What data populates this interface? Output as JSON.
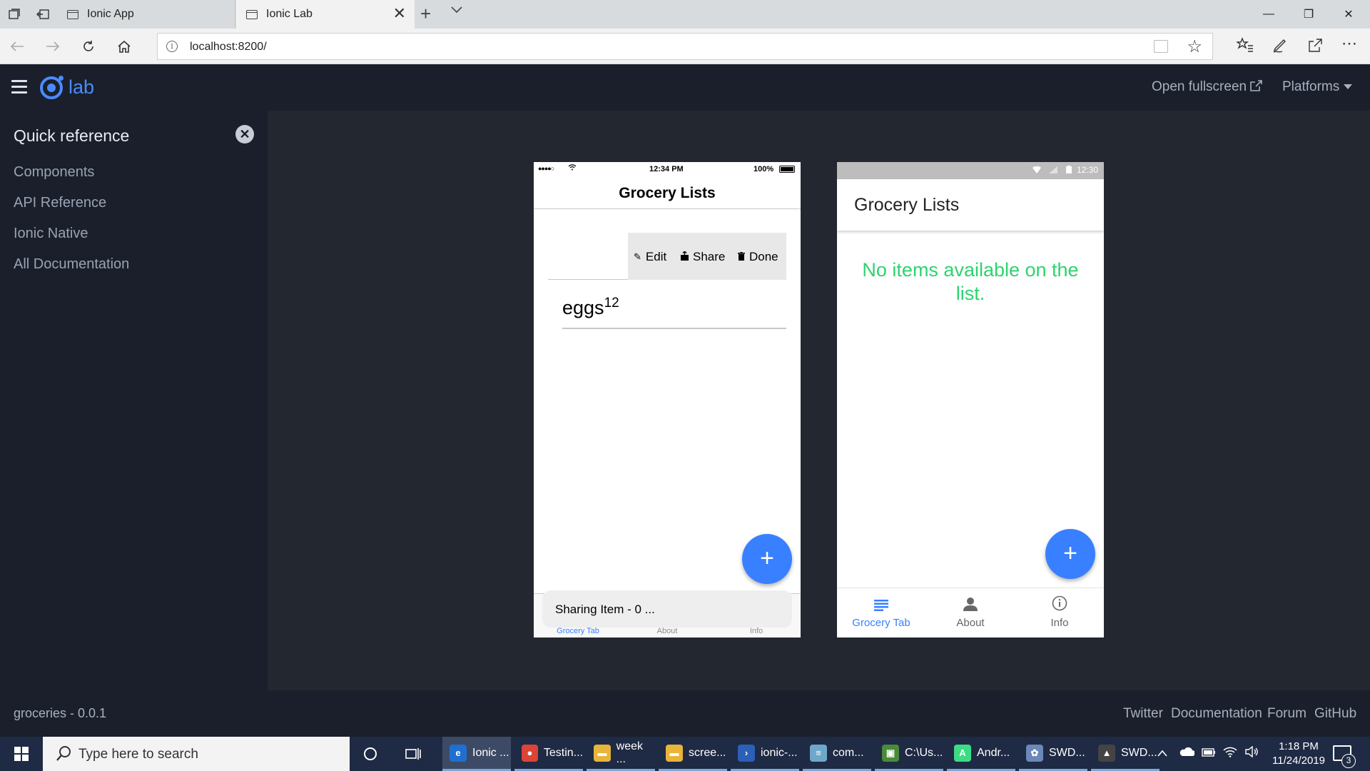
{
  "browser": {
    "tabs": [
      {
        "label": "Ionic App"
      },
      {
        "label": "Ionic Lab"
      }
    ],
    "tab_close": "✕",
    "tab_new": "+",
    "tab_list": "⌄",
    "window_controls": {
      "minimize": "—",
      "restore": "❐",
      "close": "✕"
    },
    "address": "localhost:8200/",
    "more": "⋯"
  },
  "lab": {
    "logo_text": "lab",
    "open_fullscreen": "Open fullscreen",
    "platforms": "Platforms",
    "sidebar": {
      "title": "Quick reference",
      "links": [
        "Components",
        "API Reference",
        "Ionic Native",
        "All Documentation"
      ]
    },
    "footer": {
      "version": "groceries - 0.0.1",
      "links": [
        "Twitter",
        "Documentation",
        "Forum",
        "GitHub"
      ]
    }
  },
  "ios_phone": {
    "status": {
      "time": "12:34 PM",
      "battery": "100%"
    },
    "title": "Grocery Lists",
    "item_options": [
      "Edit",
      "Share",
      "Done"
    ],
    "item": {
      "name": "eggs",
      "quantity": "12"
    },
    "fab": "+",
    "toast": "Sharing Item - 0 ...",
    "tabs": [
      "Grocery Tab",
      "About",
      "Info"
    ]
  },
  "md_phone": {
    "status": {
      "time": "12:30"
    },
    "title": "Grocery Lists",
    "empty_message": "No items available on the list.",
    "fab": "+",
    "tabs": [
      "Grocery Tab",
      "About",
      "Info"
    ]
  },
  "taskbar": {
    "search_placeholder": "Type here to search",
    "apps": [
      {
        "label": "Ionic ...",
        "icon": "edge-icon",
        "color": "#1f6fd1"
      },
      {
        "label": "Testin...",
        "icon": "chrome-icon",
        "color": "#db4437"
      },
      {
        "label": "week ...",
        "icon": "folder-icon",
        "color": "#e8b43a"
      },
      {
        "label": "scree...",
        "icon": "folder-icon",
        "color": "#e8b43a"
      },
      {
        "label": "ionic-...",
        "icon": "powershell-icon",
        "color": "#2b5fb8"
      },
      {
        "label": "com...",
        "icon": "notepad-icon",
        "color": "#6fa7c9"
      },
      {
        "label": "C:\\Us...",
        "icon": "terminal-icon",
        "color": "#4b8a3a"
      },
      {
        "label": "Andr...",
        "icon": "android-studio-icon",
        "color": "#3ddc84"
      },
      {
        "label": "SWD...",
        "icon": "paint-icon",
        "color": "#6a88b8"
      },
      {
        "label": "SWD...",
        "icon": "image-icon",
        "color": "#444444"
      }
    ],
    "clock": {
      "time": "1:18 PM",
      "date": "11/24/2019"
    },
    "notification_count": "3"
  }
}
